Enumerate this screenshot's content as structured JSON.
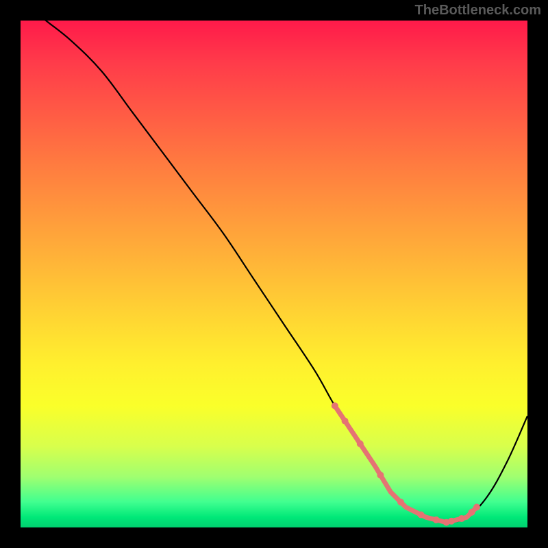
{
  "watermark": "TheBottleneck.com",
  "chart_data": {
    "type": "line",
    "title": "",
    "xlabel": "",
    "ylabel": "",
    "xlim": [
      0,
      100
    ],
    "ylim": [
      0,
      100
    ],
    "series": [
      {
        "name": "bottleneck-curve",
        "x": [
          0,
          5,
          10,
          16,
          22,
          28,
          34,
          40,
          46,
          52,
          58,
          62,
          66,
          70,
          73,
          76,
          80,
          84,
          88,
          92,
          96,
          100
        ],
        "y": [
          104,
          100,
          96,
          90,
          82,
          74,
          66,
          58,
          49,
          40,
          31,
          24,
          18,
          12,
          7,
          4,
          2,
          1,
          2,
          6,
          13,
          22
        ]
      }
    ],
    "highlight_band": {
      "name": "optimal-range",
      "x_start": 62,
      "x_end": 90,
      "color": "#e57373"
    },
    "background_gradient": {
      "top": "#ff1a4a",
      "mid": "#fff02e",
      "bottom": "#00d878"
    }
  }
}
